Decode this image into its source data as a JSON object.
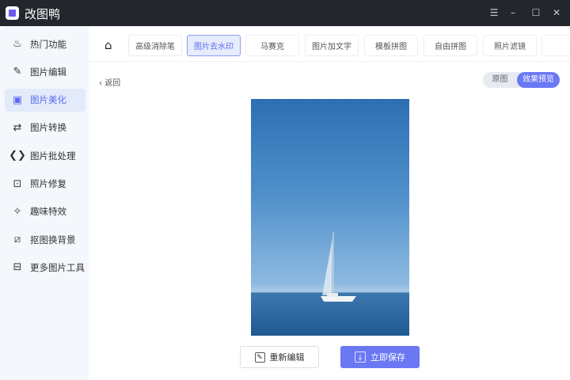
{
  "app": {
    "title": "改图鸭"
  },
  "window_controls": {
    "menu": "☰",
    "minimize": "–",
    "maximize": "☐",
    "close": "✕"
  },
  "sidebar": {
    "items": [
      {
        "label": "热门功能",
        "icon": "flame-icon",
        "glyph": "♨"
      },
      {
        "label": "图片编辑",
        "icon": "image-edit-icon",
        "glyph": "✎"
      },
      {
        "label": "图片美化",
        "icon": "image-beautify-icon",
        "glyph": "▣",
        "active": true
      },
      {
        "label": "图片转换",
        "icon": "convert-icon",
        "glyph": "⇄"
      },
      {
        "label": "图片批处理",
        "icon": "batch-icon",
        "glyph": "❮❯"
      },
      {
        "label": "照片修复",
        "icon": "photo-repair-icon",
        "glyph": "⊡"
      },
      {
        "label": "趣味特效",
        "icon": "magic-wand-icon",
        "glyph": "✧"
      },
      {
        "label": "抠图换背景",
        "icon": "cutout-icon",
        "glyph": "⧄"
      },
      {
        "label": "更多图片工具",
        "icon": "toolbox-icon",
        "glyph": "⊟"
      }
    ]
  },
  "toolbar": {
    "home_icon": "⌂",
    "tabs": [
      "高级消除笔",
      "图片去水印",
      "马赛克",
      "图片加文字",
      "模板拼图",
      "自由拼图",
      "照片滤镜"
    ],
    "active_tab": "图片去水印"
  },
  "content": {
    "back_label": "返回",
    "view_toggle": {
      "original": "原图",
      "preview": "效果预览",
      "selected": "效果预览"
    }
  },
  "actions": {
    "re_edit": "重新编辑",
    "save": "立即保存"
  },
  "colors": {
    "accent": "#6a78f3",
    "titlebar": "#23262c"
  }
}
